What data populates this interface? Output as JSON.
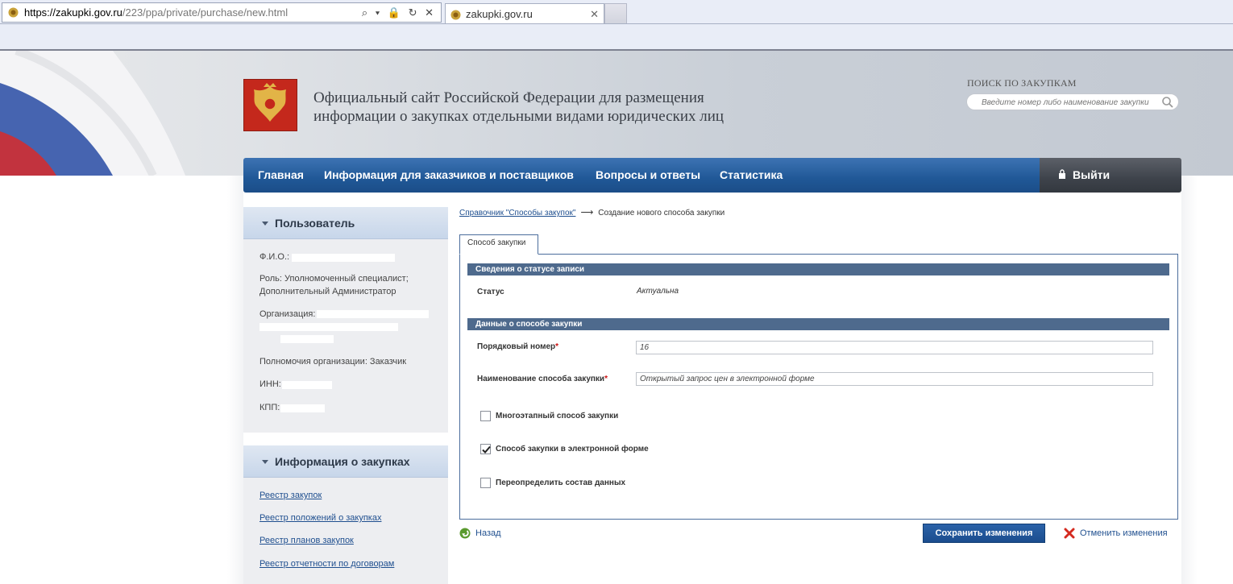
{
  "browser": {
    "url_host": "https://zakupki.gov.ru",
    "url_path": "/223/ppa/private/purchase/new.html",
    "tab_title": "zakupki.gov.ru",
    "tab_close": "✕",
    "addr_controls": "⌕ ▾ 🔒 ↻ ✕"
  },
  "header": {
    "site_title": "Официальный сайт Российской Федерации для размещения информации о закупках отдельными видами юридических лиц",
    "search_label": "ПОИСК ПО ЗАКУПКАМ",
    "search_placeholder": "Введите номер либо наименование закупки"
  },
  "nav": {
    "items": [
      "Главная",
      "Информация для заказчиков и поставщиков",
      "Вопросы и ответы",
      "Статистика"
    ],
    "logout": "Выйти"
  },
  "user_panel": {
    "title": "Пользователь",
    "fio_label": "Ф.И.О.:",
    "role_line1": "Роль: Уполномоченный специалист;",
    "role_line2": "Дополнительный Администратор",
    "org_label": "Организация:",
    "powers": "Полномочия организации: Заказчик",
    "inn_label": "ИНН:",
    "kpp_label": "КПП:"
  },
  "info_panel": {
    "title": "Информация о закупках",
    "links": [
      "Реестр закупок",
      "Реестр положений о закупках",
      "Реестр планов закупок",
      "Реестр отчетности по договорам"
    ]
  },
  "breadcrumb": {
    "link": "Справочник \"Способы закупок\"",
    "arrow": "⟶",
    "current": "Создание нового способа закупки"
  },
  "form": {
    "tab": "Способ закупки",
    "section_status": "Сведения о статусе записи",
    "status_label": "Статус",
    "status_value": "Актуальна",
    "section_data": "Данные о способе закупки",
    "number_label": "Порядковый номер",
    "number_value": "16",
    "name_label": "Наименование способа закупки",
    "name_value": "Открытый запрос цен в электронной форме",
    "required_mark": "*",
    "checkboxes": [
      {
        "label": "Многоэтапный способ закупки",
        "checked": false
      },
      {
        "label": "Способ закупки в электронной форме",
        "checked": true
      },
      {
        "label": "Переопределить состав данных",
        "checked": false
      }
    ]
  },
  "actions": {
    "back": "Назад",
    "save": "Сохранить изменения",
    "cancel": "Отменить изменения"
  },
  "colors": {
    "nav_blue": "#205897",
    "emblem_red": "#c4281c",
    "section_bar": "#4e6a8d",
    "link": "#1f4f8f"
  }
}
